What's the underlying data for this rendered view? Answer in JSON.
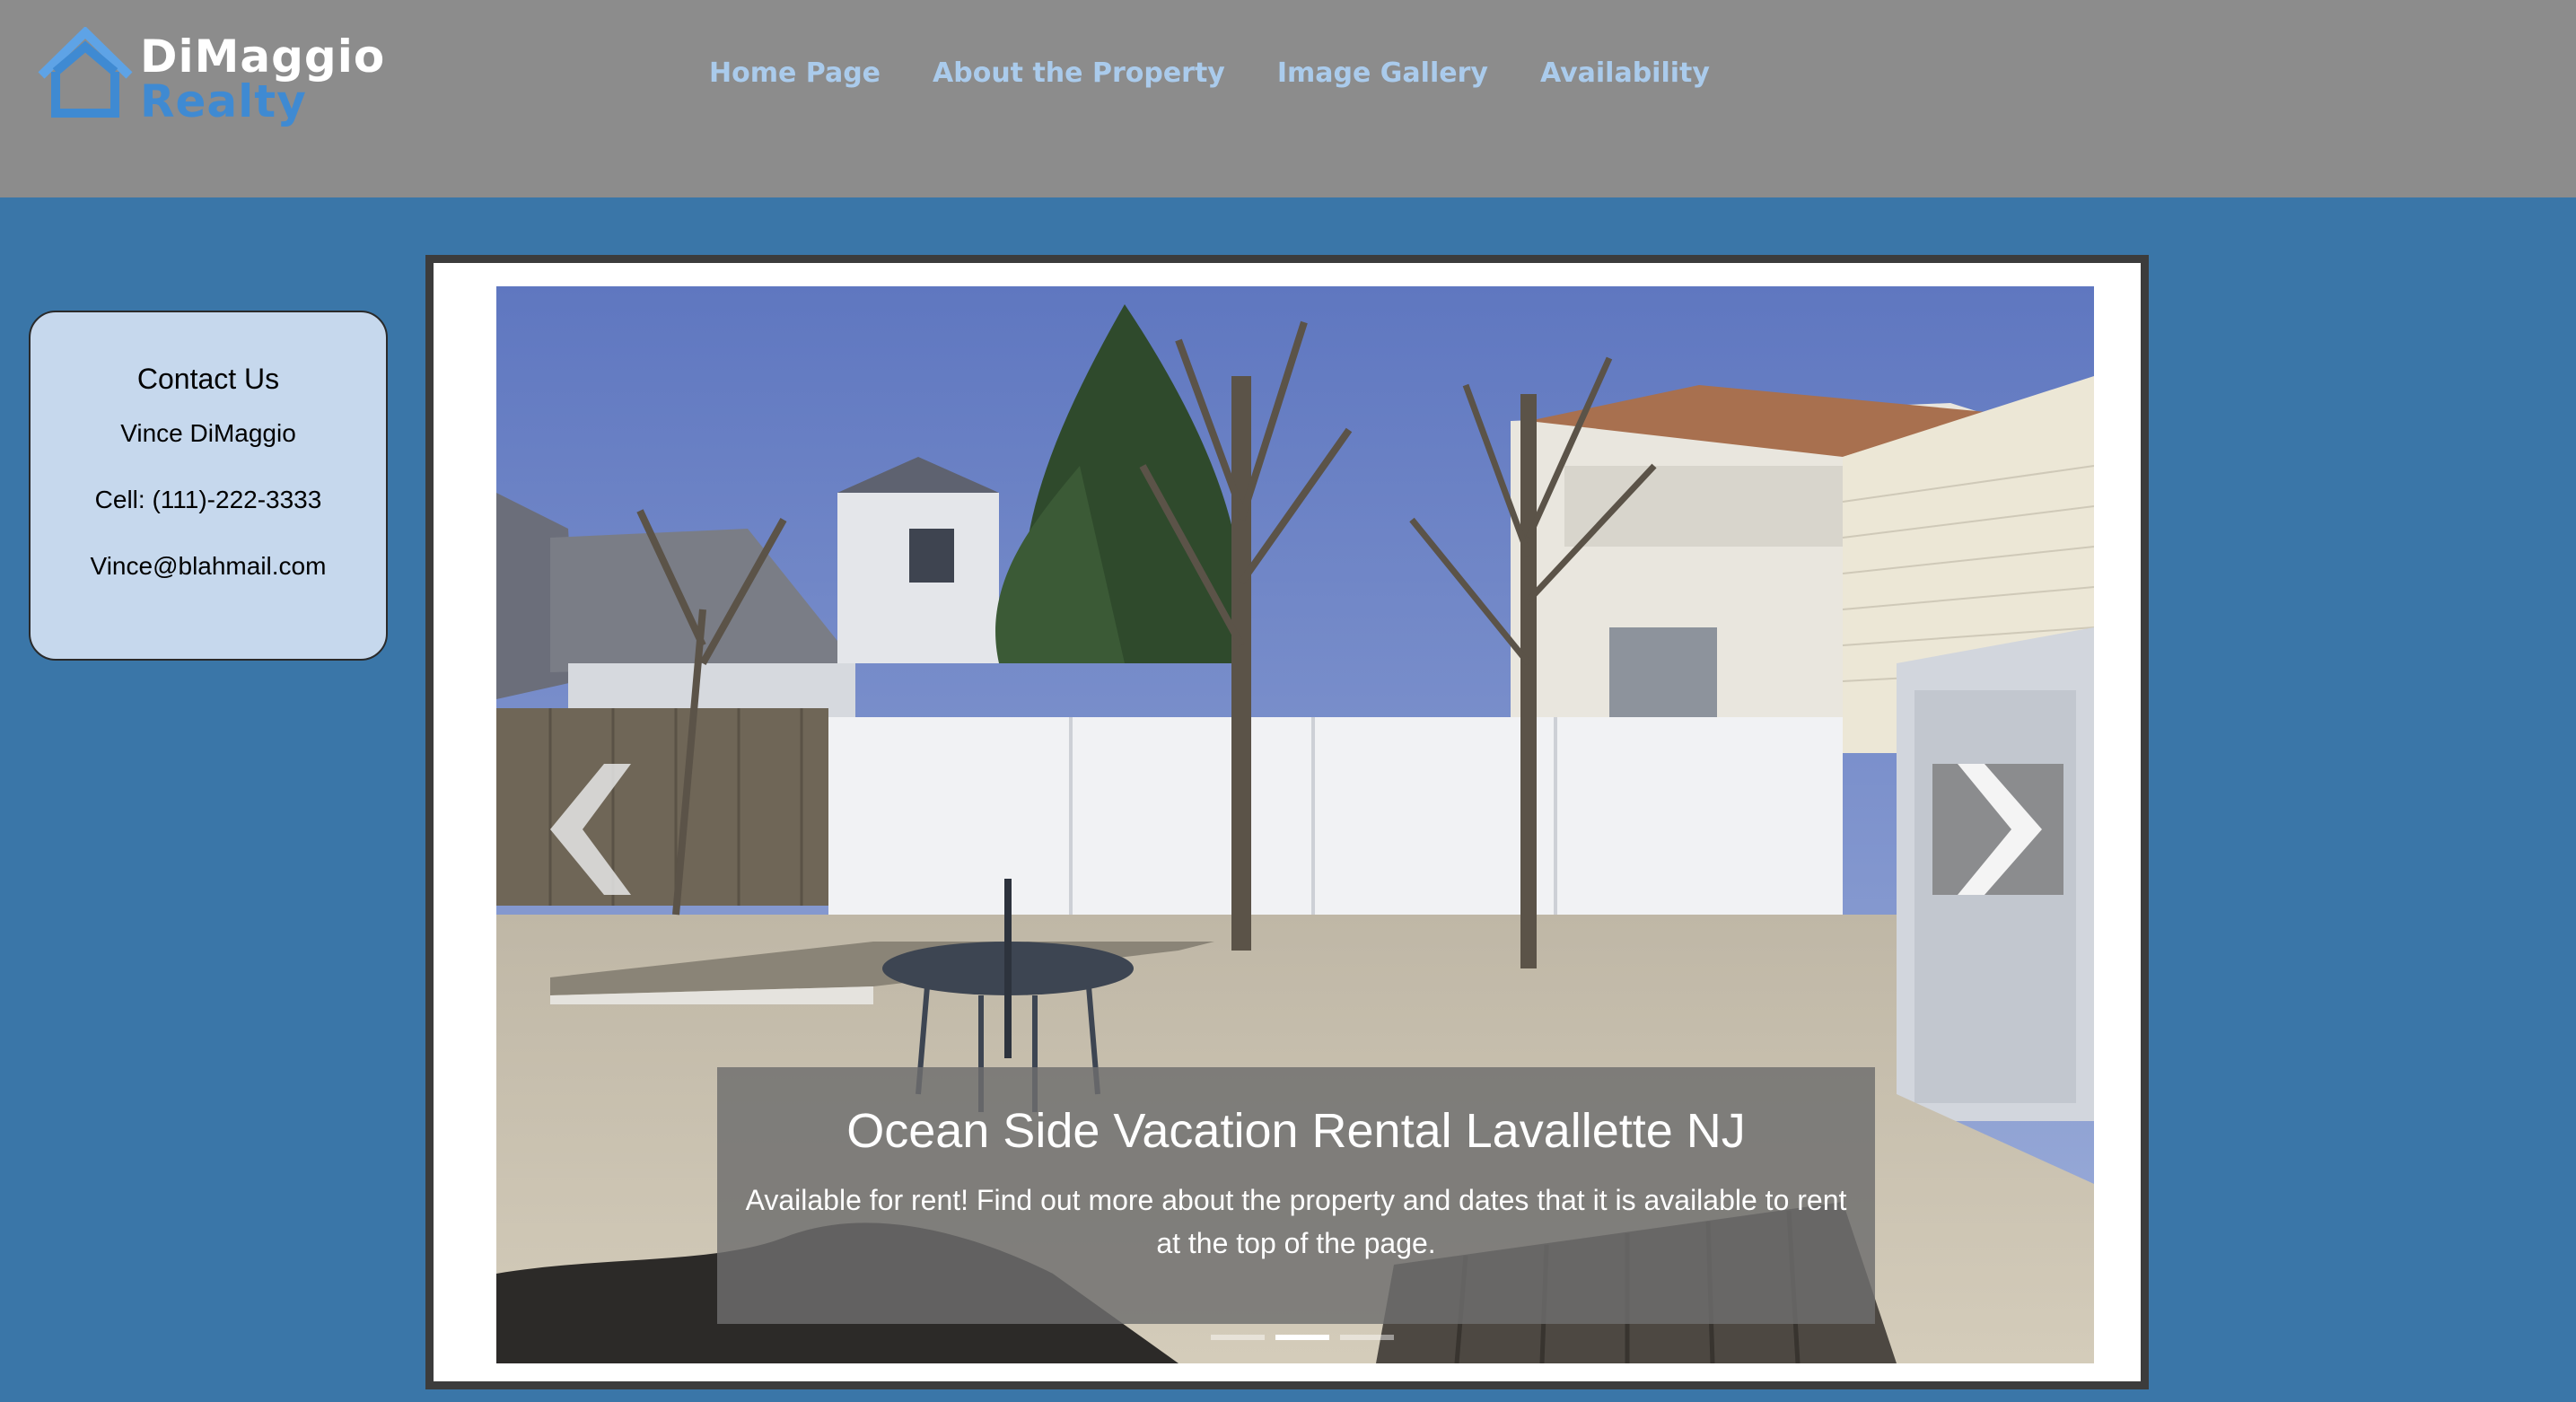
{
  "brand": {
    "name_top": "DiMaggio",
    "name_bottom": "Realty",
    "logo_icon": "house-icon",
    "colors": {
      "header_bg": "#8c8c8c",
      "page_bg": "#3a76a8",
      "logo_blue": "#3f8ad2",
      "nav_link": "#aacbec"
    }
  },
  "nav": {
    "items": [
      {
        "label": "Home Page"
      },
      {
        "label": "About the Property"
      },
      {
        "label": "Image Gallery"
      },
      {
        "label": "Availability"
      }
    ]
  },
  "contact": {
    "title": "Contact Us",
    "name": "Vince DiMaggio",
    "cell": "Cell: (111)-222-3333",
    "email": "Vince@blahmail.com"
  },
  "carousel": {
    "caption_title": "Ocean Side Vacation Rental Lavallette NJ",
    "caption_text": "Available for rent! Find out more about the property and dates that it is available to rent at the top of the page.",
    "prev_icon": "chevron-left-icon",
    "next_icon": "chevron-right-icon",
    "slide_count": 3,
    "active_slide": 2
  }
}
